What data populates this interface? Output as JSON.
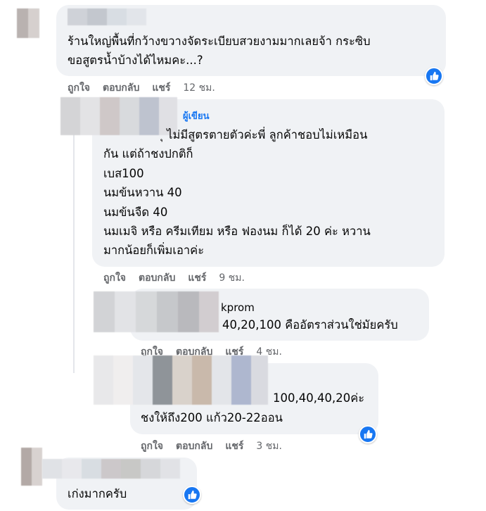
{
  "comments": [
    {
      "lines": [
        "ร้านใหญ่พื้นที่กว้างขวางจัดระเบียบสวยงามมากเลยจ้า กระซิบ",
        "ขอสูตรน้ำบ้างได้ไหมคะ...?"
      ],
      "actions": {
        "like": "ถูกใจ",
        "reply": "ตอบกลับ",
        "share": "แชร์",
        "time": "12 ชม."
      }
    },
    {
      "author_badge": "ผู้เขียน",
      "lines": [
        "ไม่มีสูตรตายตัวค่ะพี่ ลูกค้าชอบไม่เหมือน",
        "กัน แต่ถ้าชงปกติก็",
        "เบส100",
        "นมข้นหวาน 40",
        "นมข้นจืด 40",
        "นมเมจิ หรือ ครีมเทียม หรือ ฟองนม ก็ได้ 20 ค่ะ หวาน",
        "มากน้อยก็เพิ่มเอาค่ะ"
      ],
      "line_prefix": "ุ",
      "actions": {
        "like": "ถูกใจ",
        "reply": "ตอบกลับ",
        "share": "แชร์",
        "time": "9 ชม."
      }
    },
    {
      "name_suffix": "kprom",
      "lines": [
        "40,20,100 คืออัตราส่วนใช่มัยครับ"
      ],
      "actions": {
        "like": "ถูกใจ",
        "reply": "ตอบกลับ",
        "share": "แชร์",
        "time": "4 ชม."
      }
    },
    {
      "lines": [
        "100,40,40,20ค่ะ",
        "ชงให้ถึง200 แก้ว20-22ออน"
      ],
      "actions": {
        "like": "ถูกใจ",
        "reply": "ตอบกลับ",
        "share": "แชร์",
        "time": "3 ชม."
      }
    },
    {
      "lines": [
        "เก่งมากครับ"
      ]
    }
  ],
  "colors": {
    "bubble": "#f0f2f5",
    "accent": "#1877f2",
    "meta": "#65676b"
  },
  "icons": {
    "reaction": "like-thumb-icon"
  }
}
